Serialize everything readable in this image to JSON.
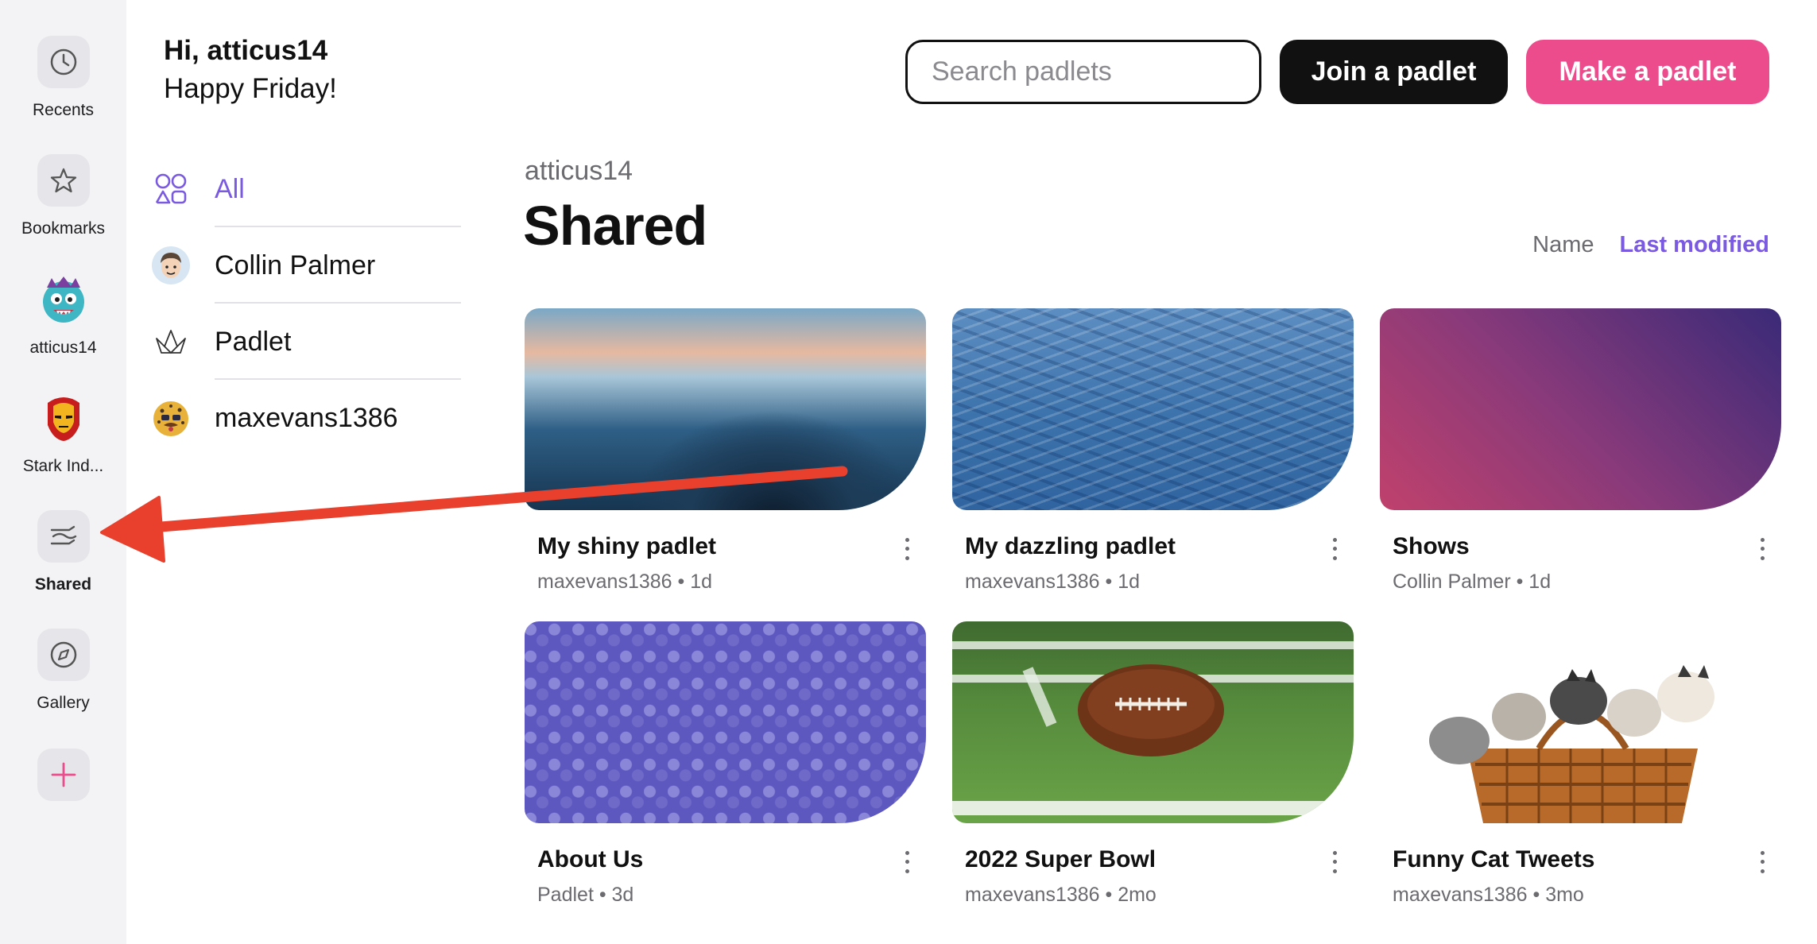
{
  "rail": {
    "items": [
      {
        "label": "Recents",
        "icon": "clock-icon"
      },
      {
        "label": "Bookmarks",
        "icon": "star-icon"
      },
      {
        "label": "atticus14",
        "icon": "monster-avatar"
      },
      {
        "label": "Stark Ind...",
        "icon": "ironman-avatar"
      },
      {
        "label": "Shared",
        "icon": "share-hands-icon"
      },
      {
        "label": "Gallery",
        "icon": "compass-icon"
      }
    ],
    "add_icon": "plus-icon"
  },
  "header": {
    "greeting": "Hi, atticus14",
    "day": "Happy Friday!",
    "search_placeholder": "Search padlets",
    "join_label": "Join a padlet",
    "make_label": "Make a padlet"
  },
  "filters": [
    {
      "label": "All",
      "icon": "grid-shapes-icon",
      "active": true
    },
    {
      "label": "Collin Palmer",
      "icon": "person-avatar"
    },
    {
      "label": "Padlet",
      "icon": "padlet-logo-icon"
    },
    {
      "label": "maxevans1386",
      "icon": "leopard-avatar"
    }
  ],
  "main": {
    "owner": "atticus14",
    "title": "Shared",
    "sort_name": "Name",
    "sort_last": "Last modified"
  },
  "cards": [
    {
      "title": "My shiny padlet",
      "author": "maxevans1386",
      "age": "1d",
      "meta": "maxevans1386 • 1d"
    },
    {
      "title": "My dazzling padlet",
      "author": "maxevans1386",
      "age": "1d",
      "meta": "maxevans1386 • 1d"
    },
    {
      "title": "Shows",
      "author": "Collin Palmer",
      "age": "1d",
      "meta": "Collin Palmer • 1d"
    },
    {
      "title": "About Us",
      "author": "Padlet",
      "age": "3d",
      "meta": "Padlet • 3d"
    },
    {
      "title": "2022 Super Bowl",
      "author": "maxevans1386",
      "age": "2mo",
      "meta": "maxevans1386 • 2mo"
    },
    {
      "title": "Funny Cat Tweets",
      "author": "maxevans1386",
      "age": "3mo",
      "meta": "maxevans1386 • 3mo"
    }
  ],
  "colors": {
    "accent_purple": "#7a5ae0",
    "make_pink": "#ec4c8b",
    "annotation_red": "#e8402c"
  }
}
